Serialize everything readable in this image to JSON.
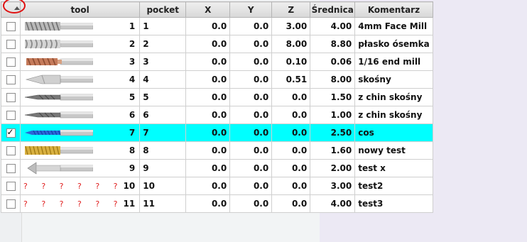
{
  "table": {
    "columns": [
      "",
      "tool",
      "pocket",
      "X",
      "Y",
      "Z",
      "Średnica",
      "Komentarz"
    ],
    "rows": [
      {
        "checked": false,
        "icon": "face-mill-icon",
        "tool": "1",
        "pocket": "1",
        "x": "0.0",
        "y": "0.0",
        "z": "3.00",
        "d": "4.00",
        "comment": "4mm Face Mill"
      },
      {
        "checked": false,
        "icon": "flat-end-mill-icon",
        "tool": "2",
        "pocket": "2",
        "x": "0.0",
        "y": "0.0",
        "z": "8.00",
        "d": "8.80",
        "comment": "płasko ósemka"
      },
      {
        "checked": false,
        "icon": "end-mill-icon",
        "tool": "3",
        "pocket": "3",
        "x": "0.0",
        "y": "0.0",
        "z": "0.10",
        "d": "0.06",
        "comment": "1/16 end mill"
      },
      {
        "checked": false,
        "icon": "drill-bit-icon",
        "tool": "4",
        "pocket": "4",
        "x": "0.0",
        "y": "0.0",
        "z": "0.51",
        "d": "8.00",
        "comment": "skośny"
      },
      {
        "checked": false,
        "icon": "engraving-bit-icon",
        "tool": "5",
        "pocket": "5",
        "x": "0.0",
        "y": "0.0",
        "z": "0.0",
        "d": "1.50",
        "comment": "z chin skośny"
      },
      {
        "checked": false,
        "icon": "engraving-bit-icon",
        "tool": "6",
        "pocket": "6",
        "x": "0.0",
        "y": "0.0",
        "z": "0.0",
        "d": "1.00",
        "comment": "z chin skośny"
      },
      {
        "checked": true,
        "icon": "blue-bit-icon",
        "tool": "7",
        "pocket": "7",
        "x": "0.0",
        "y": "0.0",
        "z": "0.0",
        "d": "2.50",
        "comment": "cos"
      },
      {
        "checked": false,
        "icon": "gold-router-bit-icon",
        "tool": "8",
        "pocket": "8",
        "x": "0.0",
        "y": "0.0",
        "z": "0.0",
        "d": "1.60",
        "comment": "nowy test"
      },
      {
        "checked": false,
        "icon": "countersink-icon",
        "tool": "9",
        "pocket": "9",
        "x": "0.0",
        "y": "0.0",
        "z": "0.0",
        "d": "2.00",
        "comment": "test x"
      },
      {
        "checked": false,
        "icon": "missing-image-icon",
        "placeholder": "? ? ? ? ? ?",
        "tool": "10",
        "pocket": "10",
        "x": "0.0",
        "y": "0.0",
        "z": "0.0",
        "d": "3.00",
        "comment": "test2"
      },
      {
        "checked": false,
        "icon": "missing-image-icon",
        "placeholder": "? ? ? ? ? ?",
        "tool": "11",
        "pocket": "11",
        "x": "0.0",
        "y": "0.0",
        "z": "0.0",
        "d": "4.00",
        "comment": "test3"
      }
    ]
  },
  "colors": {
    "selected_row": "#00ffff",
    "highlight_circle": "#e01010"
  }
}
